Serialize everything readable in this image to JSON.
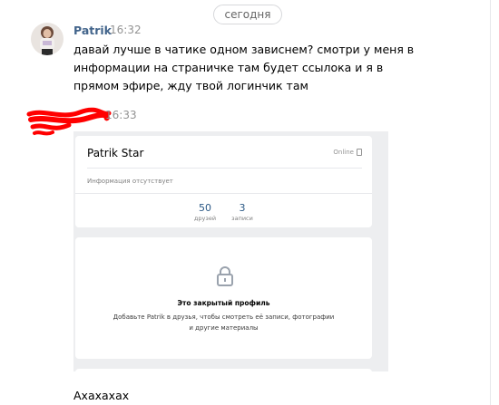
{
  "date_separator": "сегодня",
  "message1": {
    "author": "Patrik",
    "time": "16:32",
    "text": "давай лучше в чатике одном зависнем? смотри у меня в информации на страничке там будет ссылока и я в прямом эфире, жду твой логинчик там"
  },
  "message2": {
    "time": "16:33",
    "screenshot": {
      "profile_name": "Patrik Star",
      "online_status": "Online",
      "info_text": "Информация отсутствует",
      "stats": [
        {
          "value": "50",
          "label": "друзей"
        },
        {
          "value": "3",
          "label": "записи"
        }
      ],
      "closed_title": "Это закрытый профиль",
      "closed_description": "Добавьте Patrik в друзья, чтобы смотреть её записи, фотографии и другие материалы"
    },
    "icons": {
      "lock": "lock-icon",
      "phone": "phone-icon"
    },
    "redaction_color": "#ff0000"
  },
  "message3": {
    "text": "Ахахахах"
  },
  "colors": {
    "author_link": "#42648b",
    "stat_number": "#2a5885",
    "meta": "#939393"
  }
}
